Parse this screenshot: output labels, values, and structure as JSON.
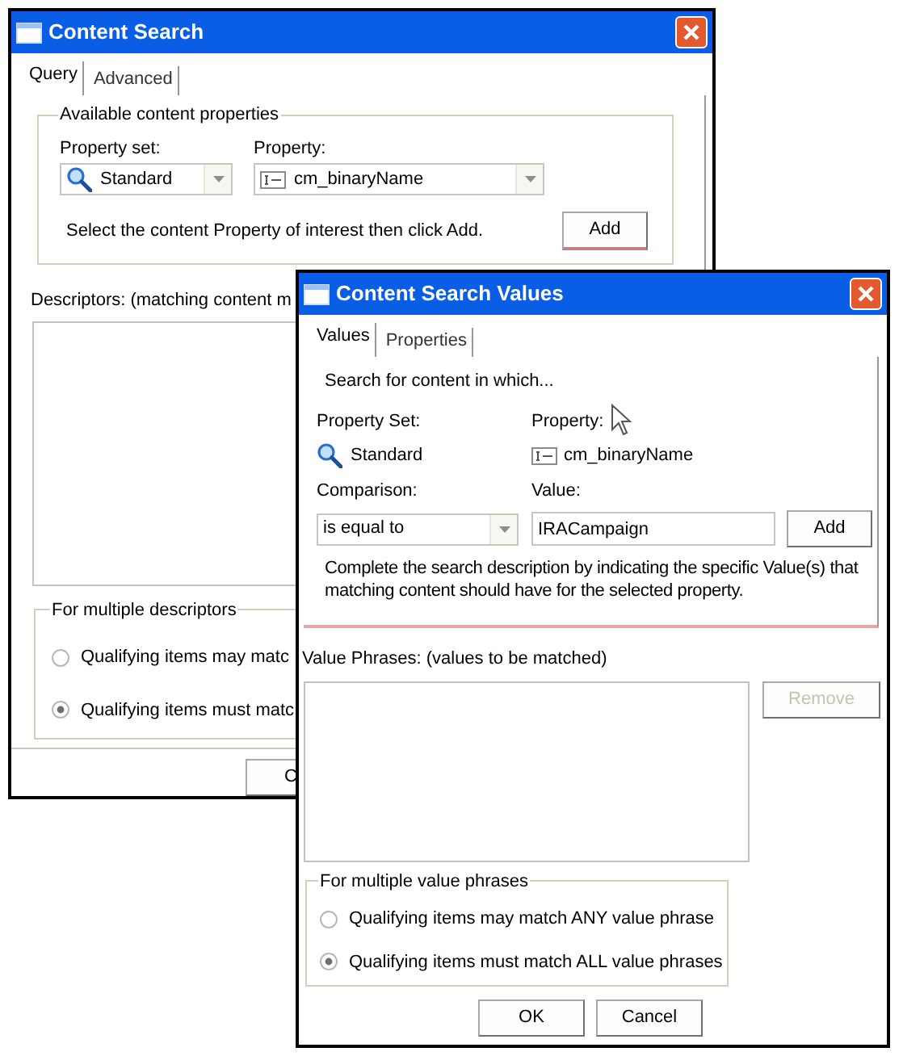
{
  "back_window": {
    "title": "Content Search",
    "tabs": [
      {
        "label": "Query",
        "selected": true
      },
      {
        "label": "Advanced",
        "selected": false
      }
    ],
    "properties_group": {
      "title": "Available content properties",
      "property_set_label": "Property set:",
      "property_set": "Standard",
      "property_label": "Property:",
      "property": "cm_binaryName",
      "hint": "Select the content Property of interest then click Add.",
      "add_button": "Add"
    },
    "descriptors_label": "Descriptors:  (matching content m",
    "multiple_group": {
      "title": "For multiple descriptors",
      "options": [
        {
          "label": "Qualifying items may matc",
          "selected": false
        },
        {
          "label": "Qualifying items must matc",
          "selected": true
        }
      ]
    },
    "buttons": [
      "C"
    ]
  },
  "front_window": {
    "title": "Content Search Values",
    "tabs": [
      {
        "label": "Values",
        "selected": true
      },
      {
        "label": "Properties",
        "selected": false
      }
    ],
    "intro": "Search for content in which...",
    "property_set_label": "Property Set:",
    "property_set": "Standard",
    "property_label": "Property:",
    "property": "cm_binaryName",
    "comparison_label": "Comparison:",
    "comparison": "is equal to",
    "value_label": "Value:",
    "value": "IRACampaign",
    "add_button": "Add",
    "hint": "Complete the search description by indicating the specific Value(s) that matching content should have for the selected property.",
    "phrases_label": "Value Phrases:  (values to be matched)",
    "remove_button": {
      "label": "Remove",
      "disabled": true
    },
    "multiple_group": {
      "title": "For multiple value phrases",
      "options": [
        {
          "label": "Qualifying items may match ANY value phrase",
          "selected": false
        },
        {
          "label": "Qualifying items must match ALL value phrases",
          "selected": true
        }
      ]
    },
    "buttons": [
      "OK",
      "Cancel"
    ]
  }
}
